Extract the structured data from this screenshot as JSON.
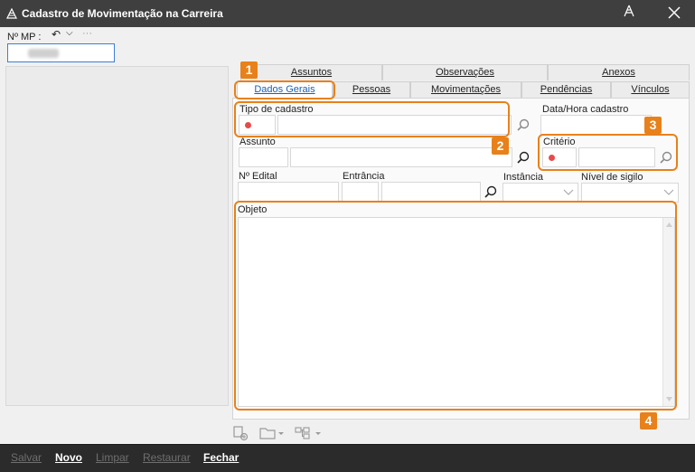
{
  "window": {
    "title": "Cadastro de Movimentação na Carreira"
  },
  "toolbar": {
    "mp_label": "Nº MP :",
    "undo_icon": "↶",
    "chevron_icon": "⌵",
    "more_icon": "···"
  },
  "tabs": {
    "row1": [
      {
        "label": "Assuntos"
      },
      {
        "label": "Observações"
      },
      {
        "label": "Anexos"
      }
    ],
    "row2": [
      {
        "label": "Dados Gerais",
        "active": true
      },
      {
        "label": "Pessoas"
      },
      {
        "label": "Movimentações"
      },
      {
        "label": "Pendências"
      },
      {
        "label": "Vínculos"
      }
    ]
  },
  "form": {
    "tipo_cadastro_label": "Tipo de cadastro",
    "data_hora_label": "Data/Hora cadastro",
    "assunto_label": "Assunto",
    "criterio_label": "Critério",
    "edital_label": "Nº Edital",
    "entrancia_label": "Entrância",
    "instancia_label": "Instância",
    "sigilo_label": "Nível de sigilo",
    "objeto_label": "Objeto"
  },
  "annotations": {
    "b1": "1",
    "b2": "2",
    "b3": "3",
    "b4": "4",
    "color": "#e8811a"
  },
  "bottom": {
    "salvar": "Salvar",
    "novo": "Novo",
    "limpar": "Limpar",
    "restaurar": "Restaurar",
    "fechar": "Fechar"
  },
  "colors": {
    "titlebar": "#3f3f3f",
    "bottombar": "#2b2b2b",
    "required": "#e84a4a",
    "active_tab_text": "#1a5fb4"
  }
}
